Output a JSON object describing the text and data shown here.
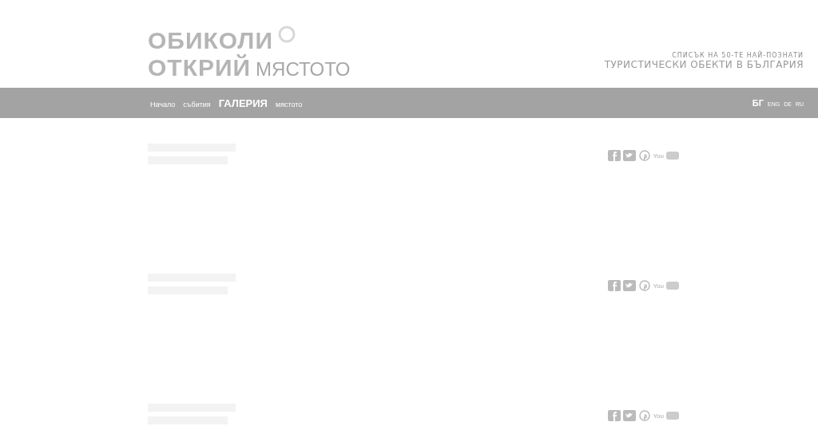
{
  "logo": {
    "line_1": "ОБИКОЛИ",
    "line_2": "ОТКРИЙ",
    "line_2_suffix": "МЯСТОТО"
  },
  "tagline": {
    "small": "СПИСЪК НА 50-ТЕ НАЙ-ПОЗНАТИ",
    "large": "ТУРИСТИЧЕСКИ ОБЕКТИ В БЪЛГАРИЯ"
  },
  "nav": [
    {
      "label": "Начало",
      "selected": false
    },
    {
      "label": "събития",
      "selected": false
    },
    {
      "label": "ГАЛЕРИЯ",
      "selected": true
    },
    {
      "label": "мястото",
      "selected": false
    }
  ],
  "languages": [
    {
      "label": "БГ",
      "selected": true
    },
    {
      "label": "ENG",
      "selected": false
    },
    {
      "label": "DE",
      "selected": false
    },
    {
      "label": "RU",
      "selected": false
    }
  ],
  "posts": [
    {
      "youtube_label": "You"
    },
    {
      "youtube_label": "You"
    },
    {
      "youtube_label": "You"
    }
  ]
}
